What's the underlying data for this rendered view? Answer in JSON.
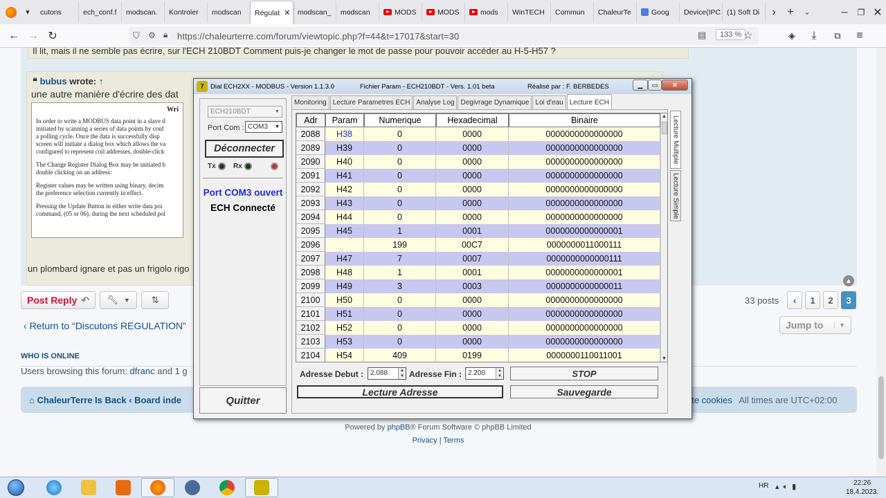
{
  "browser": {
    "tabs": [
      {
        "label": "cutons",
        "icon": "none"
      },
      {
        "label": "ech_conf.f",
        "icon": "none"
      },
      {
        "label": "modscan.",
        "icon": "none"
      },
      {
        "label": "Kontroler",
        "icon": "none"
      },
      {
        "label": "modscan",
        "icon": "none"
      },
      {
        "label": "Régulat",
        "icon": "none",
        "active": true
      },
      {
        "label": "modscan_",
        "icon": "none"
      },
      {
        "label": "modscan",
        "icon": "none"
      },
      {
        "label": "MODS",
        "icon": "youtube"
      },
      {
        "label": "MODS",
        "icon": "youtube"
      },
      {
        "label": "mods",
        "icon": "youtube"
      },
      {
        "label": "WinTECH",
        "icon": "none"
      },
      {
        "label": "Commun",
        "icon": "none"
      },
      {
        "label": "ChaleurTe",
        "icon": "none"
      },
      {
        "label": "Goog",
        "icon": "google"
      },
      {
        "label": "Device(IPC",
        "icon": "none"
      },
      {
        "label": "(1) Soft Di",
        "icon": "none"
      }
    ],
    "url": "https://chaleurterre.com/forum/viewtopic.php?f=44&t=17017&start=30",
    "zoom": "133 %"
  },
  "forum": {
    "quote_top_text": "Il lit, mais il ne semble pas écrire, sur l'ECH 210BDT Comment puis-je changer le mot de passe pour pouvoir accéder au H-5-H57 ?",
    "quote_user": "bubus",
    "quote_wrote": "wrote:",
    "quote_line": "une autre manière d'écrire des dat",
    "scan_header": "Wri",
    "scan_paragraphs": [
      "In order to write a MODBUS data point in a slave d",
      "initiated by scanning a series of data points by conf",
      "a polling cycle.  Once the data is successfully  disp",
      "screen will initiate a dialog box which allows the va",
      "configured to represent coil addresses, double-click",
      "The Change Register Dialog Box may be initiated b",
      "double clicking on an address:",
      "Register values may be written using binary, decim",
      "the preference selection currently in effect.",
      "Pressing the Update Button in either write data poi",
      "command, (05 or 06), during the next scheduled pol"
    ],
    "reply_text": "un plombard ignare et pas un frigolo rigo",
    "post_reply": "Post Reply",
    "posts_count": "33 posts",
    "pages": [
      "1",
      "2",
      "3"
    ],
    "current_page": "3",
    "return_link": "Return to “Discutons REGULATION”",
    "jump_to": "Jump to",
    "who_online": "WHO IS ONLINE",
    "browsing_prefix": "Users browsing this forum:",
    "browsing_user": "dfranc",
    "browsing_suffix": "and 1 g",
    "breadcrumb_home": "ChaleurTerre Is Back",
    "breadcrumb_board": "Board inde",
    "delete_cookies": "ete cookies",
    "times": "All times are UTC+02:00",
    "powered_prefix": "Powered by",
    "powered_link": "phpBB",
    "powered_suffix": "® Forum Software © phpBB Limited",
    "privacy": "Privacy",
    "terms": "Terms"
  },
  "app": {
    "title": "Dial ECH2XX - MODBUS - Version 1.1.3.0",
    "file": "Fichier Param - ECH210BDT - Vers. 1.01 beta",
    "author": "Réalisé par :  F. BERBEDES",
    "device": "ECH210BDT",
    "port_label": "Port Com :",
    "port_value": "COM3",
    "disconnect": "Déconnecter",
    "tx": "Tx",
    "rx": "Rx",
    "port_status": "Port COM3 ouvert",
    "ech_status": "ECH Connecté",
    "quit": "Quitter",
    "tabs": [
      "Monitoring",
      "Lecture Parametres ECH",
      "Analyse Log",
      "Degivrage Dynamique",
      "Loi d'eau",
      "Lecture ECH"
    ],
    "selected_tab": "Lecture ECH",
    "vertical_tabs": [
      "Lecture Multiple",
      "Lecture Simple"
    ],
    "columns": [
      "Adr",
      "Param",
      "Numerique",
      "Hexadecimal",
      "Binaire"
    ],
    "rows": [
      {
        "adr": "2088",
        "param": "H38",
        "num": "0",
        "hex": "0000",
        "bin": "0000000000000000"
      },
      {
        "adr": "2089",
        "param": "H39",
        "num": "0",
        "hex": "0000",
        "bin": "0000000000000000"
      },
      {
        "adr": "2090",
        "param": "H40",
        "num": "0",
        "hex": "0000",
        "bin": "0000000000000000"
      },
      {
        "adr": "2091",
        "param": "H41",
        "num": "0",
        "hex": "0000",
        "bin": "0000000000000000"
      },
      {
        "adr": "2092",
        "param": "H42",
        "num": "0",
        "hex": "0000",
        "bin": "0000000000000000"
      },
      {
        "adr": "2093",
        "param": "H43",
        "num": "0",
        "hex": "0000",
        "bin": "0000000000000000"
      },
      {
        "adr": "2094",
        "param": "H44",
        "num": "0",
        "hex": "0000",
        "bin": "0000000000000000"
      },
      {
        "adr": "2095",
        "param": "H45",
        "num": "1",
        "hex": "0001",
        "bin": "0000000000000001"
      },
      {
        "adr": "2096",
        "param": "",
        "num": "199",
        "hex": "00C7",
        "bin": "0000000011000111"
      },
      {
        "adr": "2097",
        "param": "H47",
        "num": "7",
        "hex": "0007",
        "bin": "0000000000000111"
      },
      {
        "adr": "2098",
        "param": "H48",
        "num": "1",
        "hex": "0001",
        "bin": "0000000000000001"
      },
      {
        "adr": "2099",
        "param": "H49",
        "num": "3",
        "hex": "0003",
        "bin": "0000000000000011"
      },
      {
        "adr": "2100",
        "param": "H50",
        "num": "0",
        "hex": "0000",
        "bin": "0000000000000000"
      },
      {
        "adr": "2101",
        "param": "H51",
        "num": "0",
        "hex": "0000",
        "bin": "0000000000000000"
      },
      {
        "adr": "2102",
        "param": "H52",
        "num": "0",
        "hex": "0000",
        "bin": "0000000000000000"
      },
      {
        "adr": "2103",
        "param": "H53",
        "num": "0",
        "hex": "0000",
        "bin": "0000000000000000"
      },
      {
        "adr": "2104",
        "param": "H54",
        "num": "409",
        "hex": "0199",
        "bin": "0000000110011001"
      }
    ],
    "addr_start_label": "Adresse Debut :",
    "addr_start": "2.088",
    "addr_end_label": "Adresse Fin :",
    "addr_end": "2.200",
    "stop": "STOP",
    "read_addr": "Lecture Adresse",
    "save": "Sauvegarde"
  },
  "taskbar": {
    "lang": "HR",
    "time": "22:26",
    "date": "18.4.2023."
  },
  "colors": {
    "row_odd": "#fffde0",
    "row_even": "#c6c8f0",
    "status_blue": "#1e2cd8",
    "forum_link": "#105289",
    "post_reply": "#d31141"
  }
}
